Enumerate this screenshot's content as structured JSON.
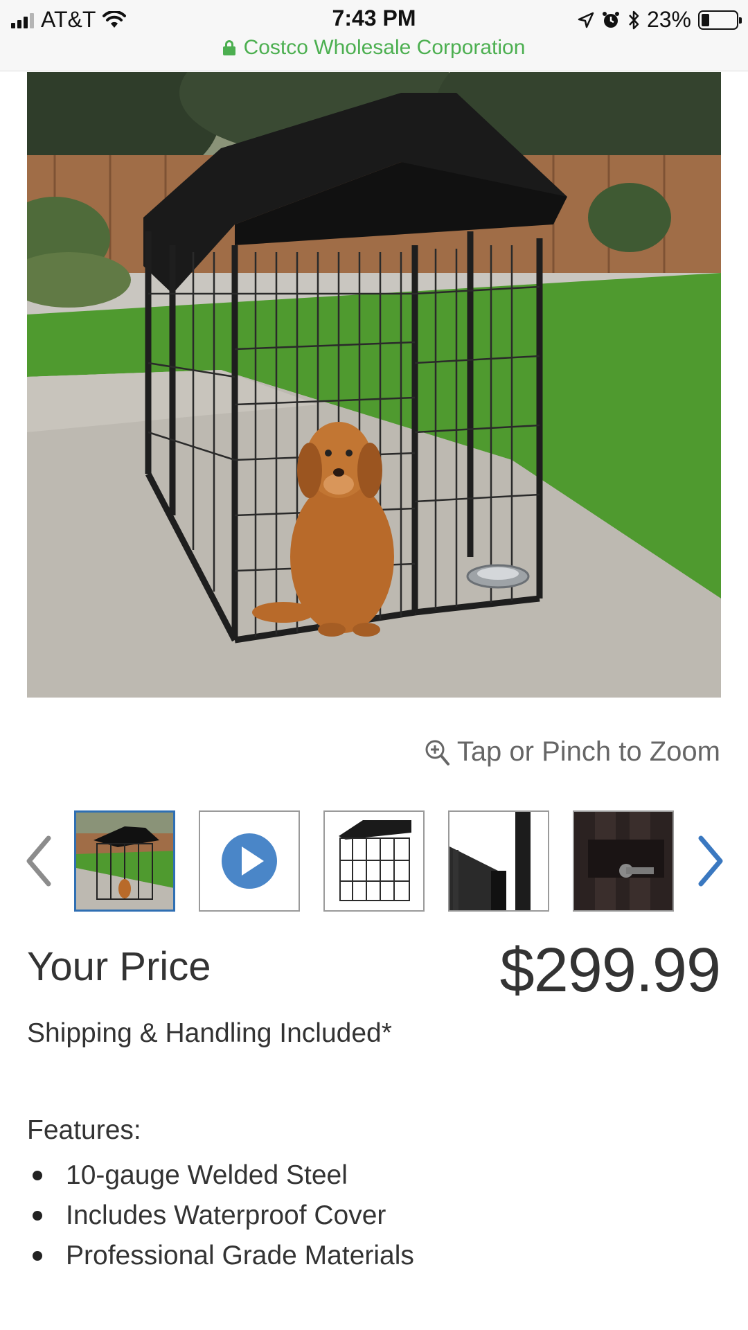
{
  "status_bar": {
    "carrier": "AT&T",
    "time": "7:43 PM",
    "battery_percent": "23%",
    "battery_level": 0.23,
    "url_text": "Costco Wholesale Corporation"
  },
  "product": {
    "zoom_hint": "Tap or Pinch to Zoom",
    "thumbnails": [
      {
        "name": "main-photo",
        "selected": true
      },
      {
        "name": "video",
        "selected": false
      },
      {
        "name": "kennel-studio",
        "selected": false
      },
      {
        "name": "corner-detail",
        "selected": false
      },
      {
        "name": "latch-detail",
        "selected": false
      }
    ],
    "price_label": "Your Price",
    "price": "$299.99",
    "shipping": "Shipping & Handling Included*",
    "features_title": "Features:",
    "features": [
      "10-gauge Welded Steel",
      "Includes Waterproof Cover",
      "Professional Grade Materials"
    ]
  },
  "colors": {
    "secure_url": "#4caf50",
    "thumb_selected": "#2f6fb3",
    "arrow_active": "#3a78c0",
    "arrow_inactive": "#8c8c8c",
    "play_button": "#4a86c8"
  }
}
